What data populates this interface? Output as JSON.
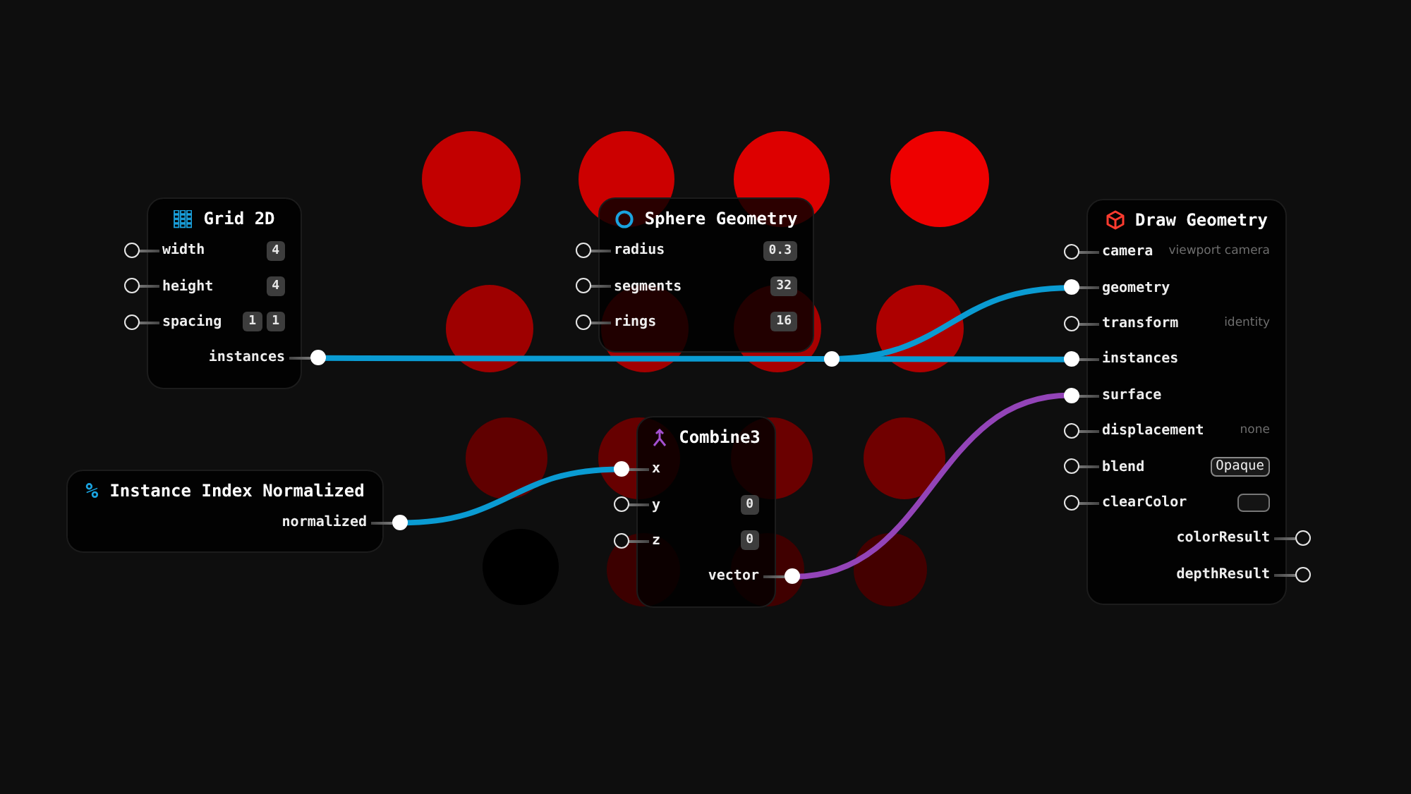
{
  "nodes": [
    {
      "title": "Grid 2D",
      "inputs": [
        {
          "label": "width",
          "connected": false,
          "kind": "badge",
          "values": [
            "4"
          ]
        },
        {
          "label": "height",
          "connected": false,
          "kind": "badge",
          "values": [
            "4"
          ]
        },
        {
          "label": "spacing",
          "connected": false,
          "kind": "badge",
          "values": [
            "1",
            "1"
          ]
        }
      ],
      "outputs": [
        {
          "label": "instances",
          "connected": true
        }
      ]
    },
    {
      "title": "Sphere Geometry",
      "inputs": [
        {
          "label": "radius",
          "connected": false,
          "kind": "badge",
          "values": [
            "0.3"
          ]
        },
        {
          "label": "segments",
          "connected": false,
          "kind": "badge",
          "values": [
            "32"
          ]
        },
        {
          "label": "rings",
          "connected": false,
          "kind": "badge",
          "values": [
            "16"
          ]
        }
      ]
    },
    {
      "title": "Instance Index Normalized",
      "icon_glyph": "%",
      "outputs": [
        {
          "label": "normalized",
          "connected": true
        }
      ]
    },
    {
      "title": "Combine3",
      "inputs": [
        {
          "label": "x",
          "connected": true,
          "kind": "plain"
        },
        {
          "label": "y",
          "connected": false,
          "kind": "badge",
          "values": [
            "0"
          ]
        },
        {
          "label": "z",
          "connected": false,
          "kind": "badge",
          "values": [
            "0"
          ]
        }
      ],
      "outputs": [
        {
          "label": "vector",
          "connected": true
        }
      ]
    },
    {
      "title": "Draw Geometry",
      "inputs": [
        {
          "label": "camera",
          "connected": false,
          "kind": "hint",
          "values": [
            "viewport camera"
          ]
        },
        {
          "label": "geometry",
          "connected": true,
          "kind": "plain"
        },
        {
          "label": "transform",
          "connected": false,
          "kind": "hint",
          "values": [
            "identity"
          ]
        },
        {
          "label": "instances",
          "connected": true,
          "kind": "plain"
        },
        {
          "label": "surface",
          "connected": true,
          "kind": "plain"
        },
        {
          "label": "displacement",
          "connected": false,
          "kind": "hint",
          "values": [
            "none"
          ]
        },
        {
          "label": "blend",
          "connected": false,
          "kind": "select",
          "values": [
            "Opaque"
          ]
        },
        {
          "label": "clearColor",
          "connected": false,
          "kind": "swatch"
        }
      ],
      "outputs": [
        {
          "label": "colorResult",
          "connected": false
        },
        {
          "label": "depthResult",
          "connected": false
        }
      ]
    }
  ],
  "wires": [
    {
      "color": "#0a9bd2"
    },
    {
      "color": "#0a9bd2"
    },
    {
      "color": "#0a9bd2"
    },
    {
      "color": "#9344b8"
    }
  ]
}
